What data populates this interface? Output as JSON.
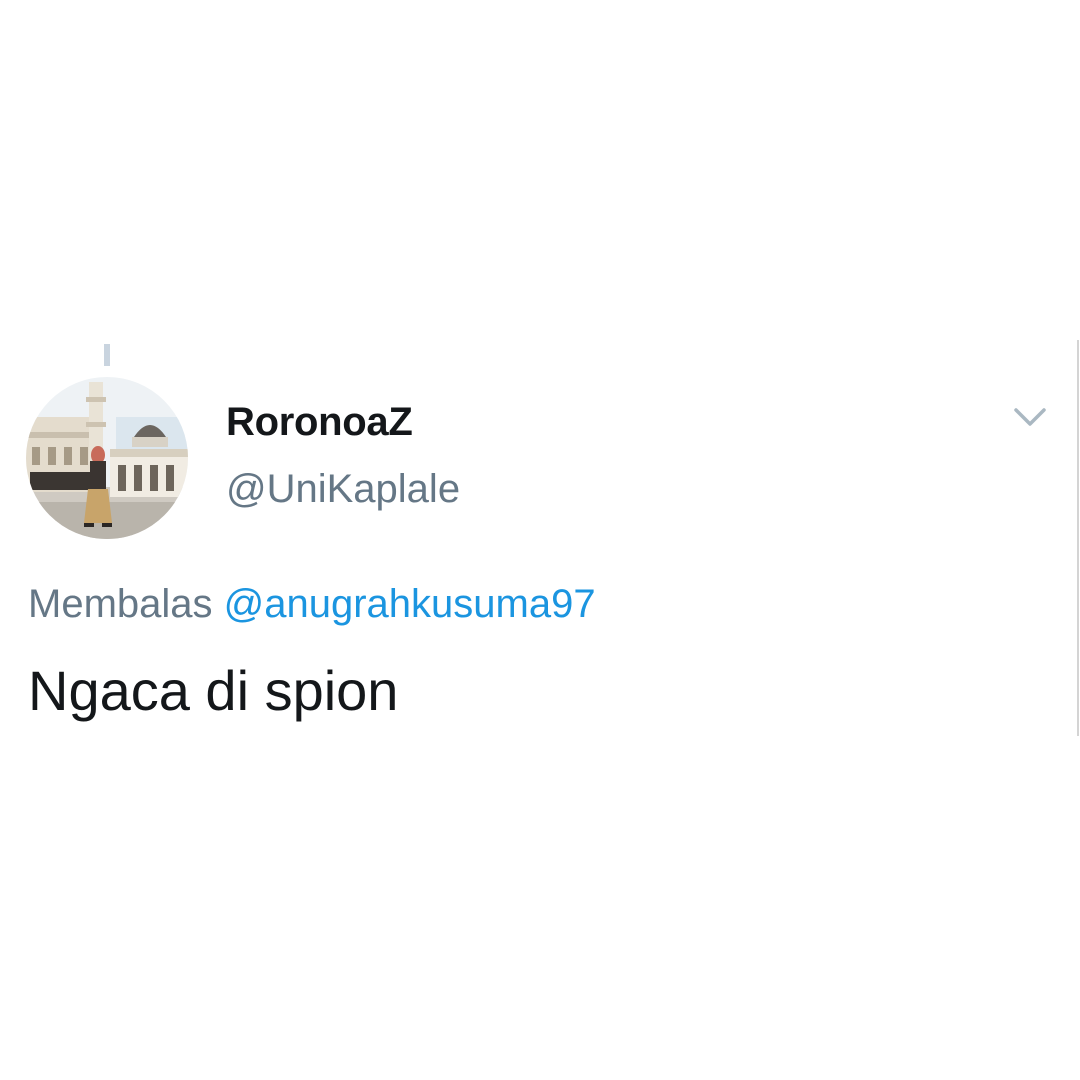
{
  "tweet": {
    "display_name": "RoronoaZ",
    "handle": "@UniKaplale",
    "reply_prefix": "Membalas",
    "reply_to": "@anugrahkusuma97",
    "text": "Ngaca di spion",
    "menu_icon": "chevron-down-icon",
    "avatar_image": "mosque-photo-avatar"
  },
  "colors": {
    "name": "#14171a",
    "secondary": "#657786",
    "mention": "#1b95e0",
    "caret": "#aab8c2"
  }
}
